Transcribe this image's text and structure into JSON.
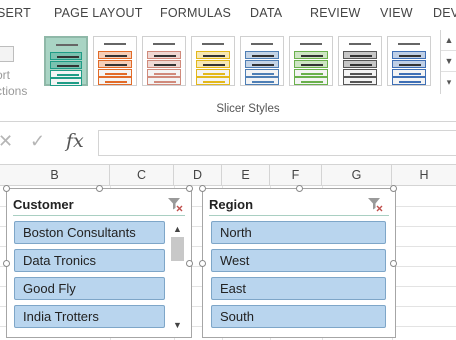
{
  "ribbon_tabs": [
    "SERT",
    "PAGE LAYOUT",
    "FORMULAS",
    "DATA",
    "REVIEW",
    "VIEW",
    "DEV"
  ],
  "sort_button": {
    "line1": "ort",
    "line2": "ctions"
  },
  "slicer_styles": {
    "group_label": "Slicer Styles",
    "tile_colors": [
      "#1f9c86",
      "#e26b28",
      "#d08a7b",
      "#e3b81a",
      "#4f7fb5",
      "#6ab04c",
      "#555555",
      "#3f6fb5"
    ],
    "selected_index": 0
  },
  "formula_bar": {
    "cancel_icon": "close-icon",
    "enter_icon": "check-icon",
    "fx_label": "fx",
    "value": ""
  },
  "columns": [
    "B",
    "C",
    "D",
    "E",
    "F",
    "G",
    "H"
  ],
  "slicers": [
    {
      "title": "Customer",
      "items": [
        "Boston Consultants",
        "Data Tronics",
        "Good Fly",
        "India Trotters"
      ],
      "has_scrollbar": true
    },
    {
      "title": "Region",
      "items": [
        "North",
        "West",
        "East",
        "South"
      ],
      "has_scrollbar": false
    }
  ],
  "colors": {
    "item_fill": "#b9d5ee",
    "item_border": "#7ea6c8",
    "selected_style": "#a9d4c4"
  }
}
